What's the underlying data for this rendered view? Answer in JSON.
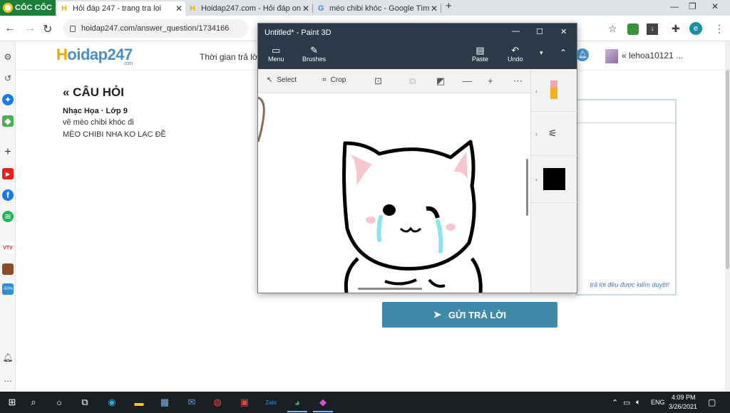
{
  "browser": {
    "brand": "CỐC CỐC",
    "tabs": [
      {
        "title": "Hỏi đáp 247 - trang tra loi",
        "close": "✕",
        "favicon": "H"
      },
      {
        "title": "Hoidap247.com - Hỏi đáp on",
        "close": "✕",
        "favicon": "H"
      },
      {
        "title": "méo chibi khóc - Google Tìm",
        "close": "✕",
        "favicon": "G"
      }
    ],
    "new_tab": "+",
    "window_controls": {
      "minimize": "—",
      "maximize": "❐",
      "close": "✕"
    },
    "nav": {
      "back": "←",
      "forward": "→",
      "reload": "↻"
    },
    "url": "hoidap247.com/answer_question/1734166",
    "profile_initial": "e"
  },
  "sidebar": {
    "icons": [
      "gear-icon",
      "history-icon",
      "messenger-icon",
      "game-icon",
      "add-icon",
      "youtube-icon",
      "facebook-icon",
      "spotify-icon",
      "vtv-icon",
      "game-art-icon",
      "promo-icon",
      "notification-icon",
      "more-icon"
    ],
    "promo_label": "-50%"
  },
  "site": {
    "logo_prefix": "H",
    "logo_rest": "oidap247",
    "logo_suffix": ".com",
    "time_label": "Thời gian trả lời",
    "username": "lehoa10121 ...",
    "user_prefix": "«"
  },
  "question": {
    "title": "« CÂU HỎI",
    "meta": "Nhạc Họa · Lớp 9",
    "line1": "vẽ mèo chibi khóc đi",
    "line2": "MÈO CHIBI NHA KO LẠC ĐỀ"
  },
  "answer": {
    "note": "trả lời đều được kiểm duyệt!",
    "submit_label": "GỬI TRẢ LỜI"
  },
  "paint": {
    "title": "Untitled* - Paint 3D",
    "ribbon": {
      "menu": "Menu",
      "brushes": "Brushes",
      "paste": "Paste",
      "undo": "Undo"
    },
    "toolbar": {
      "select": "Select",
      "crop": "Crop"
    },
    "active_color": "#000000"
  },
  "taskbar": {
    "lang": "ENG",
    "time": "4:09 PM",
    "date": "3/26/2021"
  },
  "colors": {
    "accent": "#3f8aa8",
    "paint_chrome": "#2b3a48",
    "coc_coc_green": "#1a7f37"
  }
}
